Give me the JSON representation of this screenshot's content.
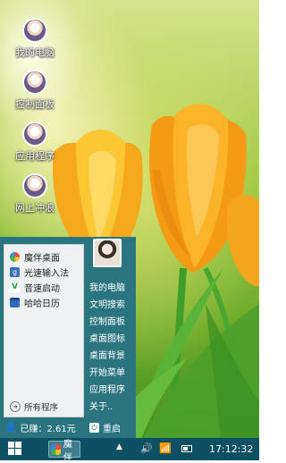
{
  "desktop_icons": [
    {
      "label": "我的电脑",
      "icon": "my-computer-avatar-icon"
    },
    {
      "label": "控制面板",
      "icon": "control-panel-avatar-icon"
    },
    {
      "label": "应用程序",
      "icon": "applications-avatar-icon"
    },
    {
      "label": "网上冲浪",
      "icon": "internet-avatar-icon"
    }
  ],
  "start_menu": {
    "apps": [
      {
        "label": "魔伴桌面",
        "icon": "pinwheel-icon",
        "color": "#2f8fd8"
      },
      {
        "label": "光速输入法",
        "icon": "keyboard-g-icon",
        "color": "#3a6fb8"
      },
      {
        "label": "音速启动",
        "icon": "v-launcher-icon",
        "color": "#2aa24a"
      },
      {
        "label": "哈哈日历",
        "icon": "calendar-icon",
        "color": "#2f6cc0"
      }
    ],
    "all_programs": "所有程序",
    "right_items": [
      "我的电脑",
      "文明搜索",
      "控制面板",
      "桌面图标",
      "桌面背景",
      "开始菜单",
      "应用程序",
      "关于.."
    ],
    "earned": "已赚：2.61元",
    "restart": "重启"
  },
  "taskbar": {
    "app_label": "魔伴",
    "tray_up": "▲",
    "volume": "🔊",
    "wifi": "📶",
    "clock": "17:12:32"
  },
  "colors": {
    "menu_bg": "#2a7480",
    "taskbar_bg": "#0d4f63",
    "left_panel_bg": "#eef1f3"
  }
}
